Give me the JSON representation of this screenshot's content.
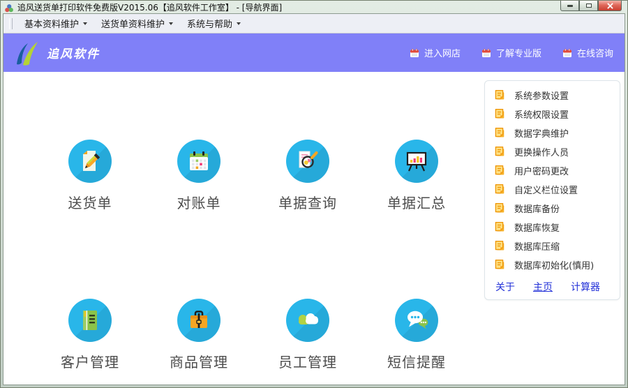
{
  "window": {
    "title": "追风送货单打印软件免费版V2015.06【追风软件工作室】 - [导航界面]",
    "controls": [
      "minimize",
      "maximize",
      "close"
    ]
  },
  "menubar": {
    "items": [
      {
        "label": "基本资料维护"
      },
      {
        "label": "送货单资料维护"
      },
      {
        "label": "系统与帮助"
      }
    ]
  },
  "header": {
    "brand": "追风软件",
    "background": "#8080f8",
    "links": [
      {
        "icon": "calendar-icon",
        "label": "进入网店"
      },
      {
        "icon": "calendar-icon",
        "label": "了解专业版"
      },
      {
        "icon": "calendar-icon",
        "label": "在线咨询"
      }
    ]
  },
  "main": {
    "tile_color": "#29b6e9",
    "tiles": [
      {
        "icon": "delivery-note-icon",
        "label": "送货单"
      },
      {
        "icon": "calendar-statement-icon",
        "label": "对账单"
      },
      {
        "icon": "search-document-icon",
        "label": "单据查询"
      },
      {
        "icon": "chart-board-icon",
        "label": "单据汇总"
      },
      {
        "icon": "notebook-icon",
        "label": "客户管理"
      },
      {
        "icon": "briefcase-icon",
        "label": "商品管理"
      },
      {
        "icon": "clouds-icon",
        "label": "员工管理"
      },
      {
        "icon": "chat-bubbles-icon",
        "label": "短信提醒"
      }
    ]
  },
  "sidebar": {
    "items": [
      {
        "icon": "note-icon",
        "label": "系统参数设置"
      },
      {
        "icon": "note-icon",
        "label": "系统权限设置"
      },
      {
        "icon": "note-icon",
        "label": "数据字典维护"
      },
      {
        "icon": "note-icon",
        "label": "更换操作人员"
      },
      {
        "icon": "note-icon",
        "label": "用户密码更改"
      },
      {
        "icon": "note-icon",
        "label": "自定义栏位设置"
      },
      {
        "icon": "note-icon",
        "label": "数据库备份"
      },
      {
        "icon": "note-icon",
        "label": "数据库恢复"
      },
      {
        "icon": "note-icon",
        "label": "数据库压缩"
      },
      {
        "icon": "note-icon",
        "label": "数据库初始化(慎用)"
      }
    ],
    "footer_links": [
      {
        "label": "关于"
      },
      {
        "label": "主页"
      },
      {
        "label": "计算器"
      }
    ],
    "link_color": "#2230d8"
  }
}
